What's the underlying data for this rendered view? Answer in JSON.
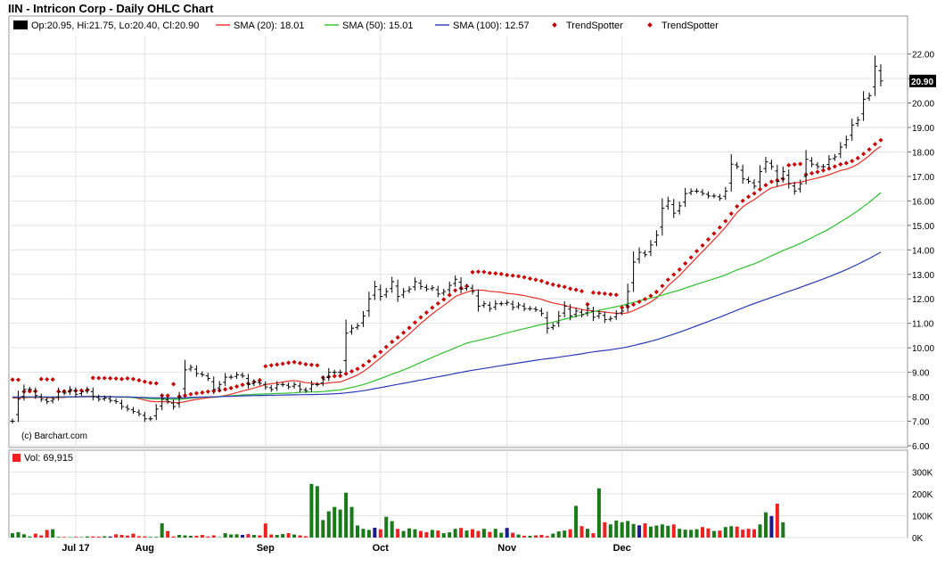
{
  "header": {
    "title": "IIN - Intricon Corp - Daily OHLC Chart"
  },
  "legend": {
    "ohlc": "Op:20.95, Hi:21.75, Lo:20.40, Cl:20.90",
    "sma20": "SMA (20): 18.01",
    "sma50": "SMA (50): 15.01",
    "sma100": "SMA (100): 12.57",
    "trend1": "TrendSpotter",
    "trend2": "TrendSpotter"
  },
  "price_panel": {
    "last_price_label": "20.90",
    "watermark": "(c) Barchart.com"
  },
  "volume_panel": {
    "label": "Vol: 69,915"
  },
  "colors": {
    "sma20": "#e8302a",
    "sma50": "#2ec02e",
    "sma100": "#2a3ab8",
    "trendspotter": "#cc0000",
    "vol_up": "#1a7a1a",
    "vol_down": "#ee2020",
    "vol_neutral": "#1a1a8c"
  },
  "chart_data": [
    {
      "type": "ohlc",
      "title": "IIN - Intricon Corp - Daily OHLC Chart",
      "ylim": [
        6,
        22.75
      ],
      "y_ticks": [
        "6.00",
        "7.00",
        "8.00",
        "9.00",
        "10.00",
        "11.00",
        "12.00",
        "13.00",
        "14.00",
        "15.00",
        "16.00",
        "17.00",
        "18.00",
        "19.00",
        "20.00",
        "21.00",
        "22.00"
      ],
      "x_tick_labels": [
        "Jul 17",
        "Aug",
        "Sep",
        "Oct",
        "Nov",
        "Dec"
      ],
      "x_tick_index": [
        11,
        23,
        44,
        64,
        86,
        106
      ],
      "close": [
        7.0,
        7.9,
        8.3,
        8.3,
        8.05,
        7.9,
        7.8,
        7.9,
        8.2,
        8.15,
        8.3,
        8.1,
        8.2,
        8.3,
        8.0,
        7.9,
        7.95,
        7.85,
        7.8,
        7.6,
        7.5,
        7.4,
        7.3,
        7.1,
        7.1,
        7.5,
        7.9,
        7.8,
        7.6,
        8.0,
        9.1,
        9.2,
        8.95,
        8.9,
        8.75,
        8.3,
        8.5,
        8.8,
        8.8,
        8.9,
        8.85,
        8.5,
        8.6,
        8.55,
        8.4,
        8.3,
        8.5,
        8.5,
        8.4,
        8.5,
        8.3,
        8.25,
        8.5,
        8.5,
        8.7,
        9.0,
        9.0,
        9.0,
        10.6,
        10.8,
        10.9,
        11.3,
        12.0,
        12.5,
        12.1,
        12.3,
        12.7,
        12.1,
        12.3,
        12.4,
        12.7,
        12.5,
        12.4,
        12.45,
        12.2,
        12.3,
        12.55,
        12.8,
        12.4,
        12.5,
        12.3,
        11.7,
        11.8,
        11.6,
        11.8,
        11.8,
        11.85,
        11.65,
        11.75,
        11.6,
        11.6,
        11.55,
        11.4,
        10.8,
        10.9,
        11.3,
        11.7,
        11.3,
        11.5,
        11.35,
        11.6,
        11.25,
        11.4,
        11.15,
        11.2,
        11.4,
        11.5,
        12.3,
        13.5,
        13.9,
        13.8,
        14.2,
        14.6,
        15.7,
        16.0,
        15.5,
        15.8,
        16.3,
        16.4,
        16.4,
        16.3,
        16.2,
        16.2,
        16.1,
        16.4,
        17.5,
        17.4,
        16.9,
        16.8,
        16.6,
        17.2,
        17.6,
        17.4,
        16.8,
        17.2,
        16.7,
        16.4,
        16.7,
        17.7,
        17.5,
        17.4,
        17.4,
        17.7,
        17.8,
        18.2,
        18.5,
        19.1,
        19.3,
        20.15,
        20.3,
        21.5,
        20.9
      ],
      "series_note": "close values approximate; each bar has open/high/low derived in script",
      "overlays": [
        {
          "name": "SMA (20)",
          "last": 18.01
        },
        {
          "name": "SMA (50)",
          "last": 15.01
        },
        {
          "name": "SMA (100)",
          "last": 12.57
        }
      ]
    },
    {
      "type": "bar",
      "title": "Vol: 69,915",
      "ylim": [
        0,
        330000
      ],
      "y_ticks": [
        "0K",
        "100K",
        "200K",
        "300K"
      ],
      "values": [
        20000,
        25000,
        15000,
        5000,
        18000,
        10000,
        35000,
        38000,
        3000,
        3000,
        2000,
        3000,
        2000,
        5000,
        5000,
        4000,
        6000,
        5000,
        15000,
        12000,
        9000,
        18000,
        6000,
        5000,
        3000,
        3000,
        65000,
        30000,
        5000,
        12000,
        10000,
        8000,
        8000,
        12000,
        5000,
        10000,
        2000,
        20000,
        14000,
        15000,
        12000,
        16000,
        12000,
        10000,
        64000,
        14000,
        12000,
        16000,
        20000,
        14000,
        10000,
        6000,
        245000,
        235000,
        80000,
        120000,
        140000,
        128000,
        205000,
        140000,
        55000,
        40000,
        35000,
        45000,
        38000,
        95000,
        75000,
        40000,
        30000,
        42000,
        38000,
        30000,
        25000,
        35000,
        32000,
        20000,
        24000,
        40000,
        44000,
        32000,
        38000,
        30000,
        40000,
        26000,
        40000,
        22000,
        44000,
        22000,
        14000,
        8000,
        8000,
        10000,
        12000,
        7000,
        18000,
        28000,
        32000,
        38000,
        145000,
        52000,
        40000,
        20000,
        225000,
        70000,
        60000,
        78000,
        70000,
        76000,
        62000,
        56000,
        65000,
        50000,
        55000,
        60000,
        54000,
        60000,
        40000,
        36000,
        35000,
        38000,
        48000,
        42000,
        30000,
        32000,
        48000,
        52000,
        50000,
        36000,
        40000,
        38000,
        60000,
        115000,
        98000,
        155000,
        69915
      ],
      "colors_note": "green = up day, red = down day"
    }
  ]
}
